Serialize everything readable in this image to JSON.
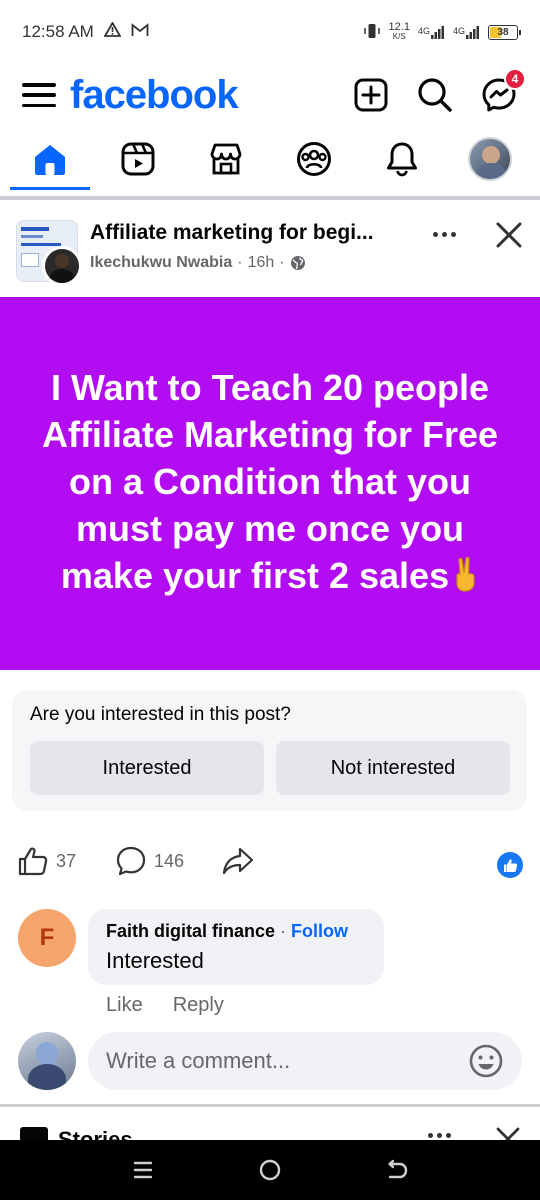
{
  "status_bar": {
    "time": "12:58 AM",
    "net_speed_top": "12.1",
    "net_speed_unit": "K/S",
    "signal1_label": "4G",
    "signal2_label": "4G",
    "battery_level": "38",
    "battery_fraction": 0.38
  },
  "header": {
    "logo": "facebook",
    "messenger_badge": "4",
    "brand_color": "#0866ff"
  },
  "nav": {
    "tabs": [
      {
        "name": "home",
        "icon": "home-icon",
        "active": true
      },
      {
        "name": "video",
        "icon": "video-icon",
        "active": false
      },
      {
        "name": "marketplace",
        "icon": "marketplace-icon",
        "active": false
      },
      {
        "name": "groups",
        "icon": "groups-icon",
        "active": false
      },
      {
        "name": "notifications",
        "icon": "bell-icon",
        "active": false
      },
      {
        "name": "profile",
        "icon": "avatar",
        "active": false
      }
    ]
  },
  "post": {
    "group_title": "Affiliate marketing for begi...",
    "author": "Ikechukwu Nwabia",
    "sep1": "·",
    "time": "16h",
    "sep2": "·",
    "privacy_icon": "globe-icon",
    "text": "I Want to Teach 20 people Affiliate Marketing for Free on a Condition that you must pay me once you make your first 2 sales",
    "background_color": "#b20cf2"
  },
  "interest": {
    "question": "Are you interested in this post?",
    "yes_label": "Interested",
    "no_label": "Not interested"
  },
  "reactions": {
    "likes": "37",
    "comments": "146"
  },
  "comment": {
    "avatar_letter": "F",
    "author": "Faith digital finance",
    "separator": "·",
    "follow_label": "Follow",
    "text": "Interested",
    "like_label": "Like",
    "reply_label": "Reply"
  },
  "composer": {
    "placeholder": "Write a comment..."
  },
  "stories": {
    "label": "Stories"
  }
}
